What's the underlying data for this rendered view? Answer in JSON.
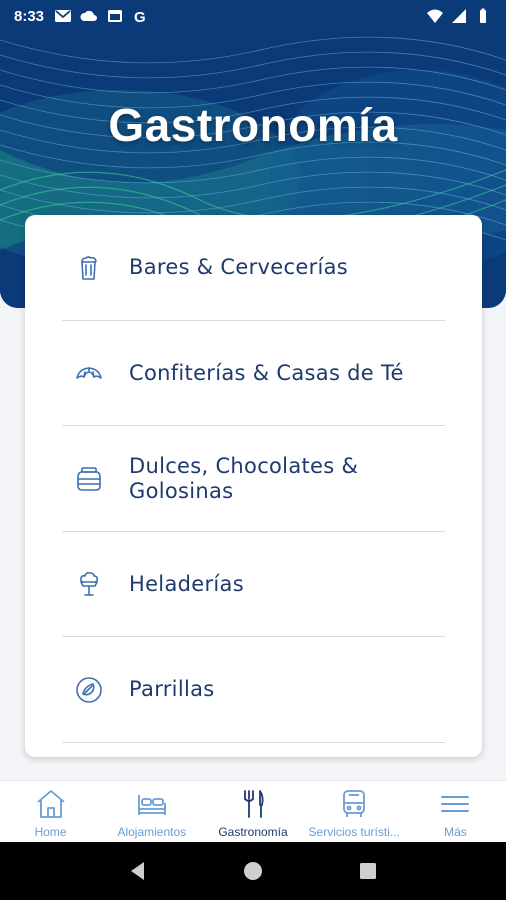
{
  "status_bar": {
    "time": "8:33",
    "left_icons": [
      "gmail-icon",
      "cloud-icon",
      "calendar-icon",
      "google-icon"
    ],
    "right_icons": [
      "wifi-icon",
      "signal-icon",
      "battery-icon"
    ]
  },
  "hero": {
    "title": "Gastronomía"
  },
  "menu": {
    "items": [
      {
        "label": "Bares & Cervecerías",
        "icon": "beer-mug-icon"
      },
      {
        "label": "Confiterías & Casas de Té",
        "icon": "croissant-icon"
      },
      {
        "label": "Dulces, Chocolates & Golosinas",
        "icon": "jar-icon"
      },
      {
        "label": "Heladerías",
        "icon": "ice-cream-icon"
      },
      {
        "label": "Parrillas",
        "icon": "grill-icon"
      }
    ]
  },
  "bottom_nav": {
    "items": [
      {
        "label": "Home",
        "icon": "home-icon",
        "active": false
      },
      {
        "label": "Alojamientos",
        "icon": "bed-icon",
        "active": false
      },
      {
        "label": "Gastronomía",
        "icon": "fork-knife-icon",
        "active": true
      },
      {
        "label": "Servicios turísti...",
        "icon": "bus-icon",
        "active": false
      },
      {
        "label": "Más",
        "icon": "menu-icon",
        "active": false
      }
    ]
  },
  "colors": {
    "primary_text": "#1f3a6d",
    "icon_blue": "#3f6fb0",
    "inactive_nav": "#6a9bd6",
    "hero_bg": "#0c3b7a"
  }
}
